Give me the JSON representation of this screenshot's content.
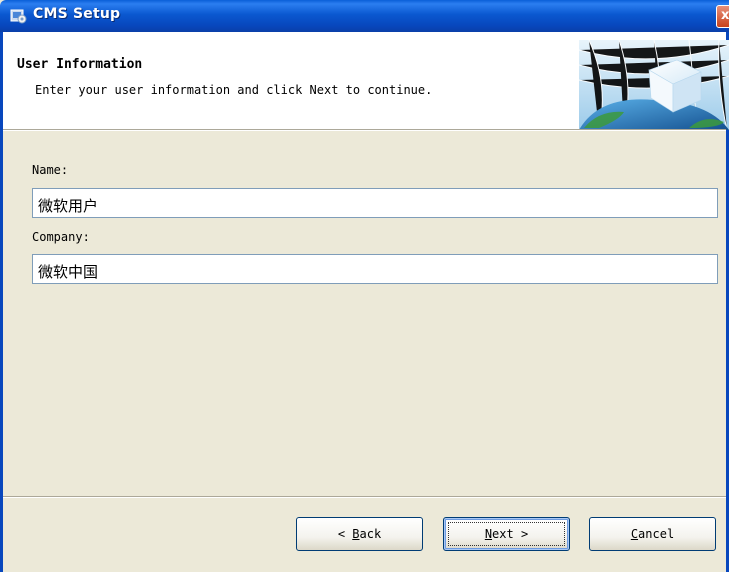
{
  "window": {
    "title": "CMS Setup",
    "close_symbol": "x"
  },
  "header": {
    "title": "User Information",
    "description": "Enter your user information and click Next to continue."
  },
  "form": {
    "name_label": "Name:",
    "name_value": "微软用户",
    "company_label": "Company:",
    "company_value": "微软中国"
  },
  "buttons": {
    "back": {
      "prefix": "< ",
      "mnemonic": "B",
      "rest": "ack"
    },
    "next": {
      "mnemonic": "N",
      "rest": "ext",
      "suffix": " >"
    },
    "cancel": {
      "mnemonic": "C",
      "rest": "ancel"
    }
  },
  "icons": {
    "title_icon": "setup-installer-icon",
    "banner": "wizard-banner-cube-globe",
    "close": "close-icon"
  },
  "colors": {
    "titlebar": "#0a58d0",
    "window_bg": "#ece9d8",
    "header_bg": "#ffffff",
    "button_border": "#003c74",
    "input_border": "#7f9db9"
  }
}
